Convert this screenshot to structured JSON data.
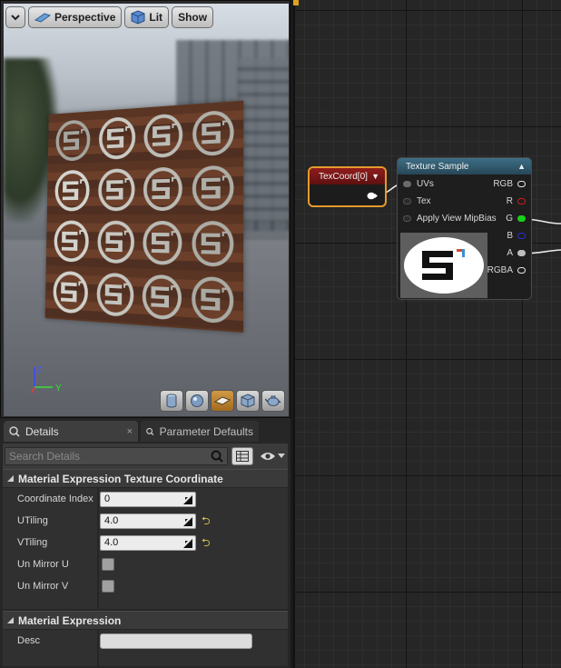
{
  "viewport": {
    "toolbar": {
      "dropdown_icon": "chevron-down-icon",
      "perspective_label": "Perspective",
      "lit_label": "Lit",
      "show_label": "Show"
    },
    "axis_labels": {
      "z": "Z",
      "y": "Y"
    },
    "preview_shapes": [
      "cylinder-icon",
      "sphere-icon",
      "plane-icon",
      "cube-icon",
      "teapot-icon"
    ],
    "active_preview_shape": "plane-icon",
    "panel_logo_count": 16
  },
  "details": {
    "tabs": [
      {
        "label": "Details",
        "close": "×"
      },
      {
        "label": "Parameter Defaults",
        "close": ""
      }
    ],
    "search": {
      "placeholder": "Search Details"
    },
    "categories": [
      {
        "title": "Material Expression Texture Coordinate",
        "properties": [
          {
            "label": "Coordinate Index",
            "value": "0"
          },
          {
            "label": "UTiling",
            "value": "4.0"
          },
          {
            "label": "VTiling",
            "value": "4.0"
          },
          {
            "label": "Un Mirror U"
          },
          {
            "label": "Un Mirror V"
          }
        ]
      },
      {
        "title": "Material Expression",
        "properties": [
          {
            "label": "Desc",
            "value": ""
          }
        ]
      }
    ],
    "reset_symbol": "⮌"
  },
  "graph": {
    "texcoord_node": {
      "title": "TexCoord[0]"
    },
    "texture_sample_node": {
      "title": "Texture Sample",
      "inputs": [
        "UVs",
        "Tex",
        "Apply View MipBias"
      ],
      "outputs": [
        "RGB",
        "R",
        "G",
        "B",
        "A",
        "RGBA"
      ]
    },
    "colors": {
      "node_selected_border": "#e59a2c",
      "texcoord_header": "#8f1c1c",
      "texture_header": "#3e6e86",
      "pin_r": "#d01a1a",
      "pin_g": "#18d018",
      "pin_b": "#2a2ad6"
    }
  }
}
